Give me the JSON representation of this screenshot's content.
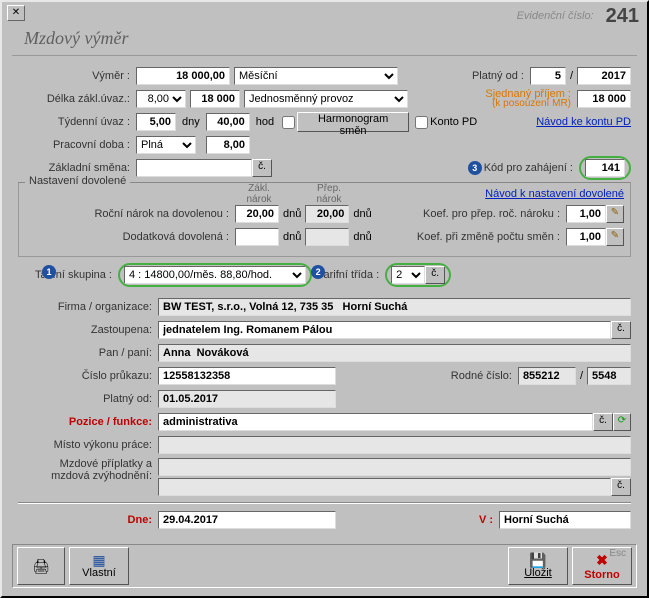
{
  "header": {
    "evidLabel": "Evidenční číslo:",
    "evidNum": "241"
  },
  "title": "Mzdový výměr",
  "vymer": {
    "lbl": "Výměr :",
    "val": "18 000,00",
    "periodSel": "Měsíční",
    "platnyOdLbl": "Platný od :",
    "platnyM": "5",
    "sep": "/",
    "platnyR": "2017"
  },
  "delka": {
    "lbl": "Délka zákl.úvaz.:",
    "val": "8,00",
    "val2": "18 000",
    "provozSel": "Jednosměnný provoz",
    "sjednanyLbl": "Sjednaný příjem :",
    "sjednanySub": "(k posouzení MR)",
    "sjednanyVal": "18 000"
  },
  "tydenni": {
    "lbl": "Týdenní úvaz :",
    "val": "5,00",
    "dnyLbl": "dny",
    "hodVal": "40,00",
    "hodLbl": "hod",
    "harmBtn": "Harmonogram směn",
    "kontoChk": "Konto PD",
    "navodLink": "Návod ke kontu PD"
  },
  "pracDoba": {
    "lbl": "Pracovní doba :",
    "sel": "Plná",
    "val": "8,00"
  },
  "zaklSmena": {
    "lbl": "Základní směna:",
    "val": ""
  },
  "kodZahajeni": {
    "lbl": "Kód pro zahájení :",
    "val": "141",
    "badge": "3"
  },
  "dovolene": {
    "legend": "Nastavení dovolené",
    "zaklNarokHdr": "Zákl. nárok",
    "prepNarokHdr": "Přep. nárok",
    "navodLink": "Návod k nastavení dovolené",
    "rocniLbl": "Roční nárok na dovolenou :",
    "rocniZ": "20,00",
    "rocniP": "20,00",
    "dnuLbl": "dnů",
    "dodatLbl": "Dodatková dovolená :",
    "dodatZ": "",
    "dodatP": "",
    "koefPrepLbl": "Koef. pro přep. roč. nároku :",
    "koefPrep": "1,00",
    "koefZmenLbl": "Koef. při změně počtu směn :",
    "koefZmen": "1,00"
  },
  "tarif": {
    "skupLbl": "Tarifní skupina :",
    "skupSel": "4 : 14800,00/měs. 88,80/hod.",
    "skupBadge": "1",
    "tridaLbl": "Tarifní třída :",
    "tridaSel": "2",
    "tridaBadge": "2"
  },
  "org": {
    "firmaLbl": "Firma / organizace:",
    "firma": "BW TEST, s.r.o., Volná 12, 735 35   Horní Suchá",
    "zastLbl": "Zastoupena:",
    "zast": "jednatelem Ing. Romanem Pálou",
    "panLbl": "Pan / paní:",
    "pan": "Anna  Nováková",
    "prukazLbl": "Číslo průkazu:",
    "prukaz": "12558132358",
    "rcLbl": "Rodné číslo:",
    "rc1": "855212",
    "rcSep": "/",
    "rc2": "5548",
    "platnyOdLbl": "Platný od:",
    "platnyOd": "01.05.2017",
    "poziceLbl": "Pozice / funkce:",
    "pozice": "administrativa",
    "mistoLbl": "Místo výkonu práce:",
    "misto": "",
    "priplatkyLbl1": "Mzdové příplatky a",
    "priplatkyLbl2": "mzdová zvýhodnění:",
    "priplat1": "",
    "priplat2": ""
  },
  "footer": {
    "dneLbl": "Dne:",
    "dne": "29.04.2017",
    "vLbl": "V :",
    "v": "Horní Suchá"
  },
  "toolbar": {
    "print": "",
    "vlastni": "Vlastní",
    "ulozit": "Uložit",
    "storno": "Storno",
    "esc": "Esc"
  }
}
